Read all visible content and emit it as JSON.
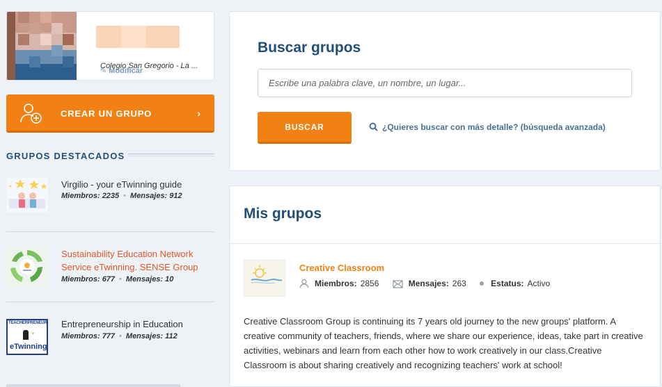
{
  "profile": {
    "school": "Colegio San Gregorio - La ...",
    "modify_label": "Modificar"
  },
  "create_group": {
    "label": "CREAR UN GRUPO"
  },
  "featured": {
    "heading": "GRUPOS DESTACADOS",
    "groups": [
      {
        "title": "Virgilio - your eTwinning guide",
        "members_label": "Miembros:",
        "members": "2235",
        "messages_label": "Mensajes:",
        "messages": "912"
      },
      {
        "title": "Sustainability Education Network Service eTwinning. SENSE Group",
        "members_label": "Miembros:",
        "members": "677",
        "messages_label": "Mensajes:",
        "messages": "10"
      },
      {
        "title": "Entrepreneurship in Education",
        "members_label": "Miembros:",
        "members": "777",
        "messages_label": "Mensajes:",
        "messages": "112",
        "thumb_text_top": "TEACHERPRENEUR",
        "thumb_text_bottom": "eTwinning"
      }
    ]
  },
  "search": {
    "title": "Buscar grupos",
    "placeholder": "Escribe una palabra clave, un nombre, un lugar...",
    "button": "BUSCAR",
    "advanced_link": "¿Quieres buscar con más detalle? (búsqueda avanzada)"
  },
  "my_groups": {
    "title": "Mis grupos",
    "group": {
      "name": "Creative Classroom",
      "members_label": "Miembros:",
      "members": "2856",
      "messages_label": "Mensajes:",
      "messages": "263",
      "status_label": "Estatus:",
      "status": "Activo",
      "description": "Creative Classroom Group is continuing its 7 years old journey to the new groups' platform. A creative community of teachers, friends, where we share our experience, ideas, take part in creative activities, webinars and learn from each other how to work creatively in our class.Creative Classroom is about sharing creatively and recognizing teachers' work at school!"
    }
  },
  "colors": {
    "accent": "#f08112",
    "heading": "#1f4e79",
    "link": "#4a6f93",
    "highlight_title": "#e0572b"
  }
}
